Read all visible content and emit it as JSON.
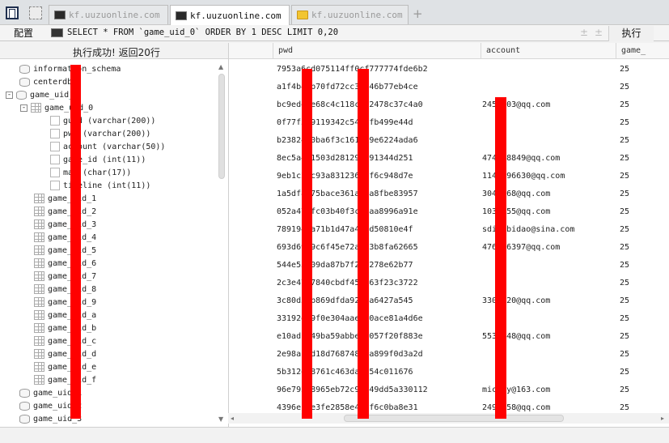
{
  "tabs": [
    {
      "label": "kf.uuzuonline.com",
      "active": false,
      "icon": "terminal-icon"
    },
    {
      "label": "kf.uuzuonline.com",
      "active": true,
      "icon": "terminal-icon"
    },
    {
      "label": "kf.uuzuonline.com",
      "active": false,
      "icon": "folder-icon"
    }
  ],
  "toolbar": {
    "config_label": "配置",
    "sql": "SELECT * FROM `game_uid_0` ORDER BY 1 DESC LIMIT 0,20",
    "execute_label": "执行",
    "plus_label": "±",
    "minus_label": "±"
  },
  "status": "执行成功! 返回20行",
  "tree": [
    {
      "label": "information_schema",
      "kind": "db"
    },
    {
      "label": "centerdb",
      "kind": "db"
    },
    {
      "label": "game_uid_0",
      "kind": "db",
      "expander": "-"
    },
    {
      "label": "game_uid_0",
      "kind": "table",
      "expander": "-"
    },
    {
      "label": "guid (varchar(200))",
      "kind": "col"
    },
    {
      "label": "pwd (varchar(200))",
      "kind": "col"
    },
    {
      "label": "account (varchar(50))",
      "kind": "col"
    },
    {
      "label": "game_id (int(11))",
      "kind": "col"
    },
    {
      "label": "mac (char(17))",
      "kind": "col"
    },
    {
      "label": "timeline (int(11))",
      "kind": "col"
    },
    {
      "label": "game_uid_1",
      "kind": "table"
    },
    {
      "label": "game_uid_2",
      "kind": "table"
    },
    {
      "label": "game_uid_3",
      "kind": "table"
    },
    {
      "label": "game_uid_4",
      "kind": "table"
    },
    {
      "label": "game_uid_5",
      "kind": "table"
    },
    {
      "label": "game_uid_6",
      "kind": "table"
    },
    {
      "label": "game_uid_7",
      "kind": "table"
    },
    {
      "label": "game_uid_8",
      "kind": "table"
    },
    {
      "label": "game_uid_9",
      "kind": "table"
    },
    {
      "label": "game_uid_a",
      "kind": "table"
    },
    {
      "label": "game_uid_b",
      "kind": "table"
    },
    {
      "label": "game_uid_c",
      "kind": "table"
    },
    {
      "label": "game_uid_d",
      "kind": "table"
    },
    {
      "label": "game_uid_e",
      "kind": "table"
    },
    {
      "label": "game_uid_f",
      "kind": "table"
    },
    {
      "label": "game_uid_1",
      "kind": "db"
    },
    {
      "label": "game_uid_2",
      "kind": "db"
    },
    {
      "label": "game_uid_3",
      "kind": "db"
    }
  ],
  "grid": {
    "columns": [
      "pwd",
      "account",
      "game_"
    ],
    "rows": [
      {
        "pwd": "7953a6cd075114ff0cf777774fde6b2",
        "account": "",
        "game": "25"
      },
      {
        "pwd": "a1f4b4cb70fd72cc30046b77eb4ce",
        "account": "",
        "game": "25"
      },
      {
        "pwd": "bc9ede5e68c4c118c9f2478c37c4a0",
        "account": "2451503@qq.com",
        "game": "25"
      },
      {
        "pwd": "0f77f579119342c541dfb499e44d",
        "account": "",
        "game": "25"
      },
      {
        "pwd": "b23824c0ba6f3c1616f9e6224ada6",
        "account": "",
        "game": "25"
      },
      {
        "pwd": "8ec5a4d1503d281291591344d251",
        "account": "474838849@qq.com",
        "game": "25"
      },
      {
        "pwd": "9eb1c2ec93a83123663f6c948d7e",
        "account": "1142396630@qq.com",
        "game": "25"
      },
      {
        "pwd": "1a5df8575bace361aada8fbe83957",
        "account": "3040768@qq.com",
        "game": "25"
      },
      {
        "pwd": "052a47cfc03b40f3ce3aa8996a91e",
        "account": "1035655@qq.com",
        "game": "25"
      },
      {
        "pwd": "7891942a71b1d47a4d4d50810e4f",
        "account": "sdianbidao@sina.com",
        "game": "25"
      },
      {
        "pwd": "693d6929c6f45e72a783b8fa62665",
        "account": "476576397@qq.com",
        "game": "25"
      },
      {
        "pwd": "544e53c09da87b7f2e7278e62b77",
        "account": "",
        "game": "25"
      },
      {
        "pwd": "2c3e4787840cbdf458663f23c3722",
        "account": "",
        "game": "25"
      },
      {
        "pwd": "3c80d5fb869dfda9211a6427a545",
        "account": "3303520@qq.com",
        "game": "25"
      },
      {
        "pwd": "33192da9f0e304aaef60ace81a4d6e",
        "account": "",
        "game": "25"
      },
      {
        "pwd": "e10adc949ba59abbe5e057f20f883e",
        "account": "5535548@qq.com",
        "game": "25"
      },
      {
        "pwd": "2e98a1bd18d76874835a899f0d3a2d",
        "account": "",
        "game": "25"
      },
      {
        "pwd": "5b312e28761c463da5a54c011676",
        "account": "",
        "game": "25"
      },
      {
        "pwd": "96e79218965eb72c92549dd5a330112",
        "account": "mickey@163.com",
        "game": "25"
      },
      {
        "pwd": "4396ec2e3fe2858e448f6c0ba8e31",
        "account": "2498658@qq.com",
        "game": "25"
      }
    ]
  },
  "colors": {
    "redaction": "#ff0000",
    "tab_active": "#ffffff",
    "background": "#f2f2f2"
  }
}
